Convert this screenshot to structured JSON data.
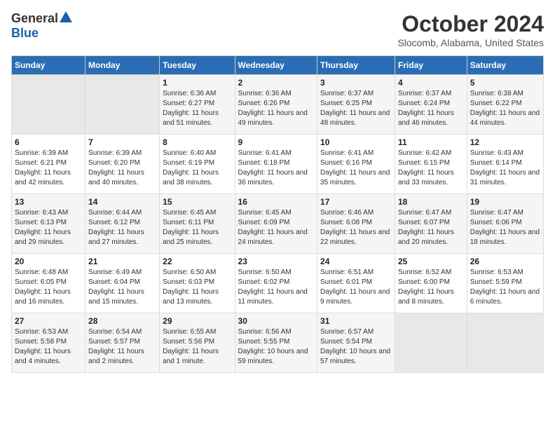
{
  "logo": {
    "general": "General",
    "blue": "Blue"
  },
  "title": {
    "month": "October 2024",
    "location": "Slocomb, Alabama, United States"
  },
  "headers": [
    "Sunday",
    "Monday",
    "Tuesday",
    "Wednesday",
    "Thursday",
    "Friday",
    "Saturday"
  ],
  "weeks": [
    [
      {
        "day": "",
        "sunrise": "",
        "sunset": "",
        "daylight": ""
      },
      {
        "day": "",
        "sunrise": "",
        "sunset": "",
        "daylight": ""
      },
      {
        "day": "1",
        "sunrise": "Sunrise: 6:36 AM",
        "sunset": "Sunset: 6:27 PM",
        "daylight": "Daylight: 11 hours and 51 minutes."
      },
      {
        "day": "2",
        "sunrise": "Sunrise: 6:36 AM",
        "sunset": "Sunset: 6:26 PM",
        "daylight": "Daylight: 11 hours and 49 minutes."
      },
      {
        "day": "3",
        "sunrise": "Sunrise: 6:37 AM",
        "sunset": "Sunset: 6:25 PM",
        "daylight": "Daylight: 11 hours and 48 minutes."
      },
      {
        "day": "4",
        "sunrise": "Sunrise: 6:37 AM",
        "sunset": "Sunset: 6:24 PM",
        "daylight": "Daylight: 11 hours and 46 minutes."
      },
      {
        "day": "5",
        "sunrise": "Sunrise: 6:38 AM",
        "sunset": "Sunset: 6:22 PM",
        "daylight": "Daylight: 11 hours and 44 minutes."
      }
    ],
    [
      {
        "day": "6",
        "sunrise": "Sunrise: 6:39 AM",
        "sunset": "Sunset: 6:21 PM",
        "daylight": "Daylight: 11 hours and 42 minutes."
      },
      {
        "day": "7",
        "sunrise": "Sunrise: 6:39 AM",
        "sunset": "Sunset: 6:20 PM",
        "daylight": "Daylight: 11 hours and 40 minutes."
      },
      {
        "day": "8",
        "sunrise": "Sunrise: 6:40 AM",
        "sunset": "Sunset: 6:19 PM",
        "daylight": "Daylight: 11 hours and 38 minutes."
      },
      {
        "day": "9",
        "sunrise": "Sunrise: 6:41 AM",
        "sunset": "Sunset: 6:18 PM",
        "daylight": "Daylight: 11 hours and 36 minutes."
      },
      {
        "day": "10",
        "sunrise": "Sunrise: 6:41 AM",
        "sunset": "Sunset: 6:16 PM",
        "daylight": "Daylight: 11 hours and 35 minutes."
      },
      {
        "day": "11",
        "sunrise": "Sunrise: 6:42 AM",
        "sunset": "Sunset: 6:15 PM",
        "daylight": "Daylight: 11 hours and 33 minutes."
      },
      {
        "day": "12",
        "sunrise": "Sunrise: 6:43 AM",
        "sunset": "Sunset: 6:14 PM",
        "daylight": "Daylight: 11 hours and 31 minutes."
      }
    ],
    [
      {
        "day": "13",
        "sunrise": "Sunrise: 6:43 AM",
        "sunset": "Sunset: 6:13 PM",
        "daylight": "Daylight: 11 hours and 29 minutes."
      },
      {
        "day": "14",
        "sunrise": "Sunrise: 6:44 AM",
        "sunset": "Sunset: 6:12 PM",
        "daylight": "Daylight: 11 hours and 27 minutes."
      },
      {
        "day": "15",
        "sunrise": "Sunrise: 6:45 AM",
        "sunset": "Sunset: 6:11 PM",
        "daylight": "Daylight: 11 hours and 25 minutes."
      },
      {
        "day": "16",
        "sunrise": "Sunrise: 6:45 AM",
        "sunset": "Sunset: 6:09 PM",
        "daylight": "Daylight: 11 hours and 24 minutes."
      },
      {
        "day": "17",
        "sunrise": "Sunrise: 6:46 AM",
        "sunset": "Sunset: 6:08 PM",
        "daylight": "Daylight: 11 hours and 22 minutes."
      },
      {
        "day": "18",
        "sunrise": "Sunrise: 6:47 AM",
        "sunset": "Sunset: 6:07 PM",
        "daylight": "Daylight: 11 hours and 20 minutes."
      },
      {
        "day": "19",
        "sunrise": "Sunrise: 6:47 AM",
        "sunset": "Sunset: 6:06 PM",
        "daylight": "Daylight: 11 hours and 18 minutes."
      }
    ],
    [
      {
        "day": "20",
        "sunrise": "Sunrise: 6:48 AM",
        "sunset": "Sunset: 6:05 PM",
        "daylight": "Daylight: 11 hours and 16 minutes."
      },
      {
        "day": "21",
        "sunrise": "Sunrise: 6:49 AM",
        "sunset": "Sunset: 6:04 PM",
        "daylight": "Daylight: 11 hours and 15 minutes."
      },
      {
        "day": "22",
        "sunrise": "Sunrise: 6:50 AM",
        "sunset": "Sunset: 6:03 PM",
        "daylight": "Daylight: 11 hours and 13 minutes."
      },
      {
        "day": "23",
        "sunrise": "Sunrise: 6:50 AM",
        "sunset": "Sunset: 6:02 PM",
        "daylight": "Daylight: 11 hours and 11 minutes."
      },
      {
        "day": "24",
        "sunrise": "Sunrise: 6:51 AM",
        "sunset": "Sunset: 6:01 PM",
        "daylight": "Daylight: 11 hours and 9 minutes."
      },
      {
        "day": "25",
        "sunrise": "Sunrise: 6:52 AM",
        "sunset": "Sunset: 6:00 PM",
        "daylight": "Daylight: 11 hours and 8 minutes."
      },
      {
        "day": "26",
        "sunrise": "Sunrise: 6:53 AM",
        "sunset": "Sunset: 5:59 PM",
        "daylight": "Daylight: 11 hours and 6 minutes."
      }
    ],
    [
      {
        "day": "27",
        "sunrise": "Sunrise: 6:53 AM",
        "sunset": "Sunset: 5:58 PM",
        "daylight": "Daylight: 11 hours and 4 minutes."
      },
      {
        "day": "28",
        "sunrise": "Sunrise: 6:54 AM",
        "sunset": "Sunset: 5:57 PM",
        "daylight": "Daylight: 11 hours and 2 minutes."
      },
      {
        "day": "29",
        "sunrise": "Sunrise: 6:55 AM",
        "sunset": "Sunset: 5:56 PM",
        "daylight": "Daylight: 11 hours and 1 minute."
      },
      {
        "day": "30",
        "sunrise": "Sunrise: 6:56 AM",
        "sunset": "Sunset: 5:55 PM",
        "daylight": "Daylight: 10 hours and 59 minutes."
      },
      {
        "day": "31",
        "sunrise": "Sunrise: 6:57 AM",
        "sunset": "Sunset: 5:54 PM",
        "daylight": "Daylight: 10 hours and 57 minutes."
      },
      {
        "day": "",
        "sunrise": "",
        "sunset": "",
        "daylight": ""
      },
      {
        "day": "",
        "sunrise": "",
        "sunset": "",
        "daylight": ""
      }
    ]
  ]
}
